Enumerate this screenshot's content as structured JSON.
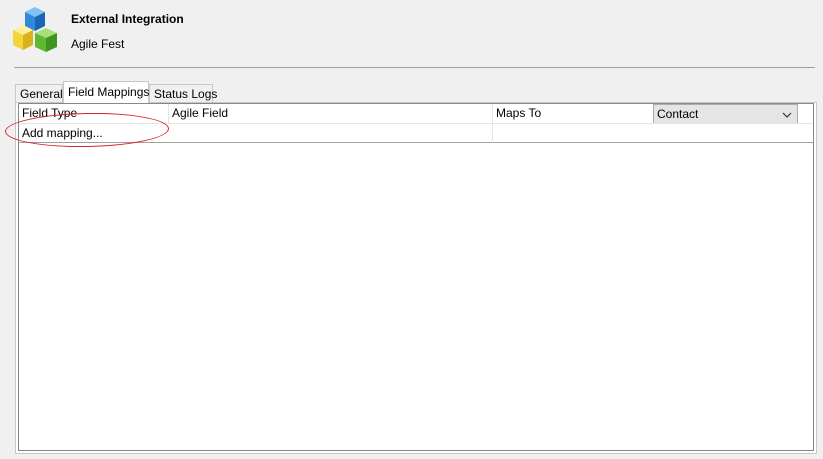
{
  "header": {
    "title": "External Integration",
    "subtitle": "Agile Fest",
    "icon": "integration-cubes-icon"
  },
  "tabs": [
    {
      "label": "General",
      "active": false
    },
    {
      "label": "Field Mappings",
      "active": true
    },
    {
      "label": "Status Logs",
      "active": false
    }
  ],
  "grid": {
    "columns": [
      "Field Type",
      "Agile Field",
      "Maps To"
    ],
    "maps_to_select": {
      "selected": "Contact",
      "icon": "chevron-down-icon"
    },
    "rows": [
      {
        "field_type": "Add mapping...",
        "agile_field": "",
        "maps_to": ""
      }
    ]
  },
  "colors": {
    "highlight": "#d8232a",
    "window_bg": "#f0f0f0"
  }
}
